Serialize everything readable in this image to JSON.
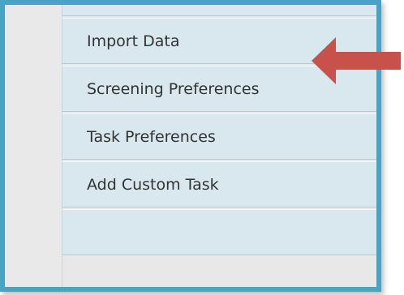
{
  "menu": {
    "items": [
      {
        "label": "Import Data"
      },
      {
        "label": "Screening Preferences"
      },
      {
        "label": "Task Preferences"
      },
      {
        "label": "Add Custom Task"
      }
    ]
  },
  "annotation": {
    "arrow_color": "#c9514b",
    "frame_color": "#4aa3c3"
  }
}
